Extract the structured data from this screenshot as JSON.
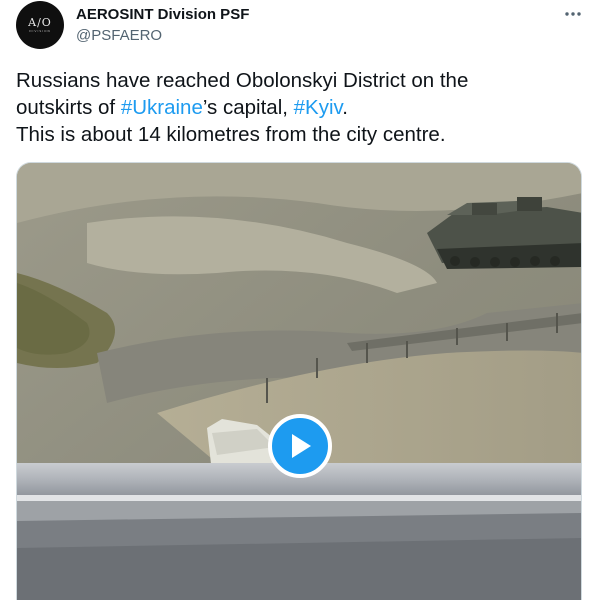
{
  "author": {
    "display_name": "AEROSINT Division PSF",
    "handle": "@PSFAERO",
    "avatar_text": "A/O",
    "avatar_subtext": "DIVISION"
  },
  "tweet": {
    "line1": "Russians have reached Obolonskyi District on the",
    "line2_before": "outskirts of ",
    "hashtag_ukraine": "#Ukraine",
    "line2_middle": "’s capital, ",
    "hashtag_kyiv": "#Kyiv",
    "line2_after": ".",
    "line3": "This is about 14 kilometres from the city centre."
  },
  "icons": {
    "more": "more-horizontal-icon",
    "play": "play-icon"
  },
  "colors": {
    "link": "#1d9bf0",
    "text": "#0f1419",
    "secondary": "#536471"
  }
}
